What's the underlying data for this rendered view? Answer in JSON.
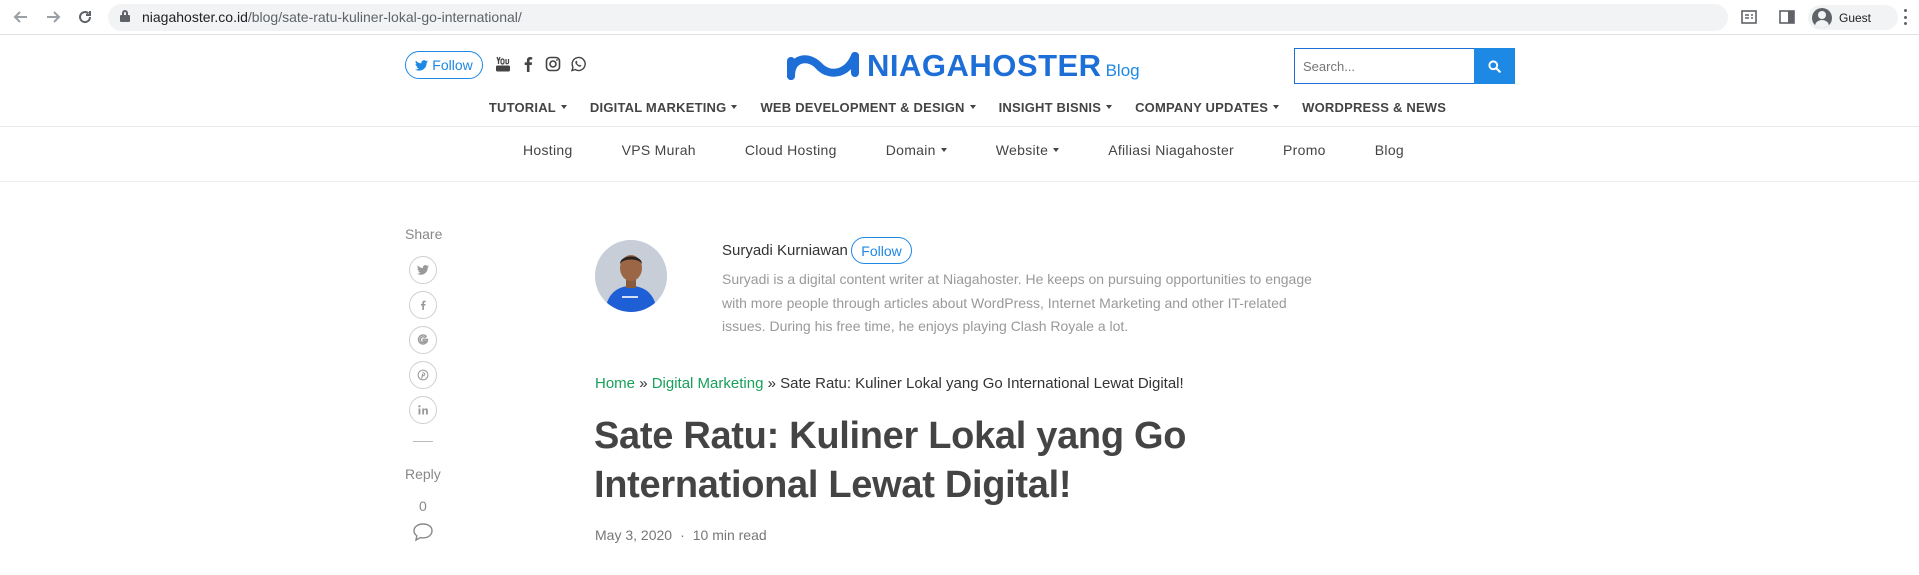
{
  "browser": {
    "url_host": "niagahoster.co.id",
    "url_path": "/blog/sate-ratu-kuliner-lokal-go-international/",
    "profile_label": "Guest"
  },
  "header": {
    "follow_label": "Follow",
    "logo_text": "NIAGAHOSTER",
    "logo_sub": "Blog",
    "search_placeholder": "Search...",
    "accent_color": "#1e88e5"
  },
  "main_menu": [
    {
      "label": "TUTORIAL",
      "dropdown": true
    },
    {
      "label": "DIGITAL MARKETING",
      "dropdown": true
    },
    {
      "label": "WEB DEVELOPMENT & DESIGN",
      "dropdown": true
    },
    {
      "label": "INSIGHT BISNIS",
      "dropdown": true
    },
    {
      "label": "COMPANY UPDATES",
      "dropdown": true
    },
    {
      "label": "WORDPRESS & NEWS",
      "dropdown": false
    }
  ],
  "sub_menu": [
    {
      "label": "Hosting",
      "dropdown": false
    },
    {
      "label": "VPS Murah",
      "dropdown": false
    },
    {
      "label": "Cloud Hosting",
      "dropdown": false
    },
    {
      "label": "Domain",
      "dropdown": true
    },
    {
      "label": "Website",
      "dropdown": true
    },
    {
      "label": "Afiliasi Niagahoster",
      "dropdown": false
    },
    {
      "label": "Promo",
      "dropdown": false
    },
    {
      "label": "Blog",
      "dropdown": false
    }
  ],
  "share": {
    "label": "Share",
    "reply_label": "Reply",
    "reply_count": "0"
  },
  "author": {
    "name": "Suryadi Kurniawan",
    "follow_label": "Follow",
    "bio": "Suryadi is a digital content writer at Niagahoster. He keeps on pursuing opportunities to engage with more people through articles about WordPress, Internet Marketing and other IT-related issues. During his free time, he enjoys playing Clash Royale a lot."
  },
  "breadcrumb": {
    "home": "Home",
    "sep1": "»",
    "category": "Digital Marketing",
    "sep2": "»",
    "current": "Sate Ratu: Kuliner Lokal yang Go International Lewat Digital!"
  },
  "article": {
    "title": "Sate Ratu: Kuliner Lokal yang Go International Lewat Digital!",
    "date": "May 3, 2020",
    "meta_sep": "·",
    "read_time": "10 min read"
  }
}
